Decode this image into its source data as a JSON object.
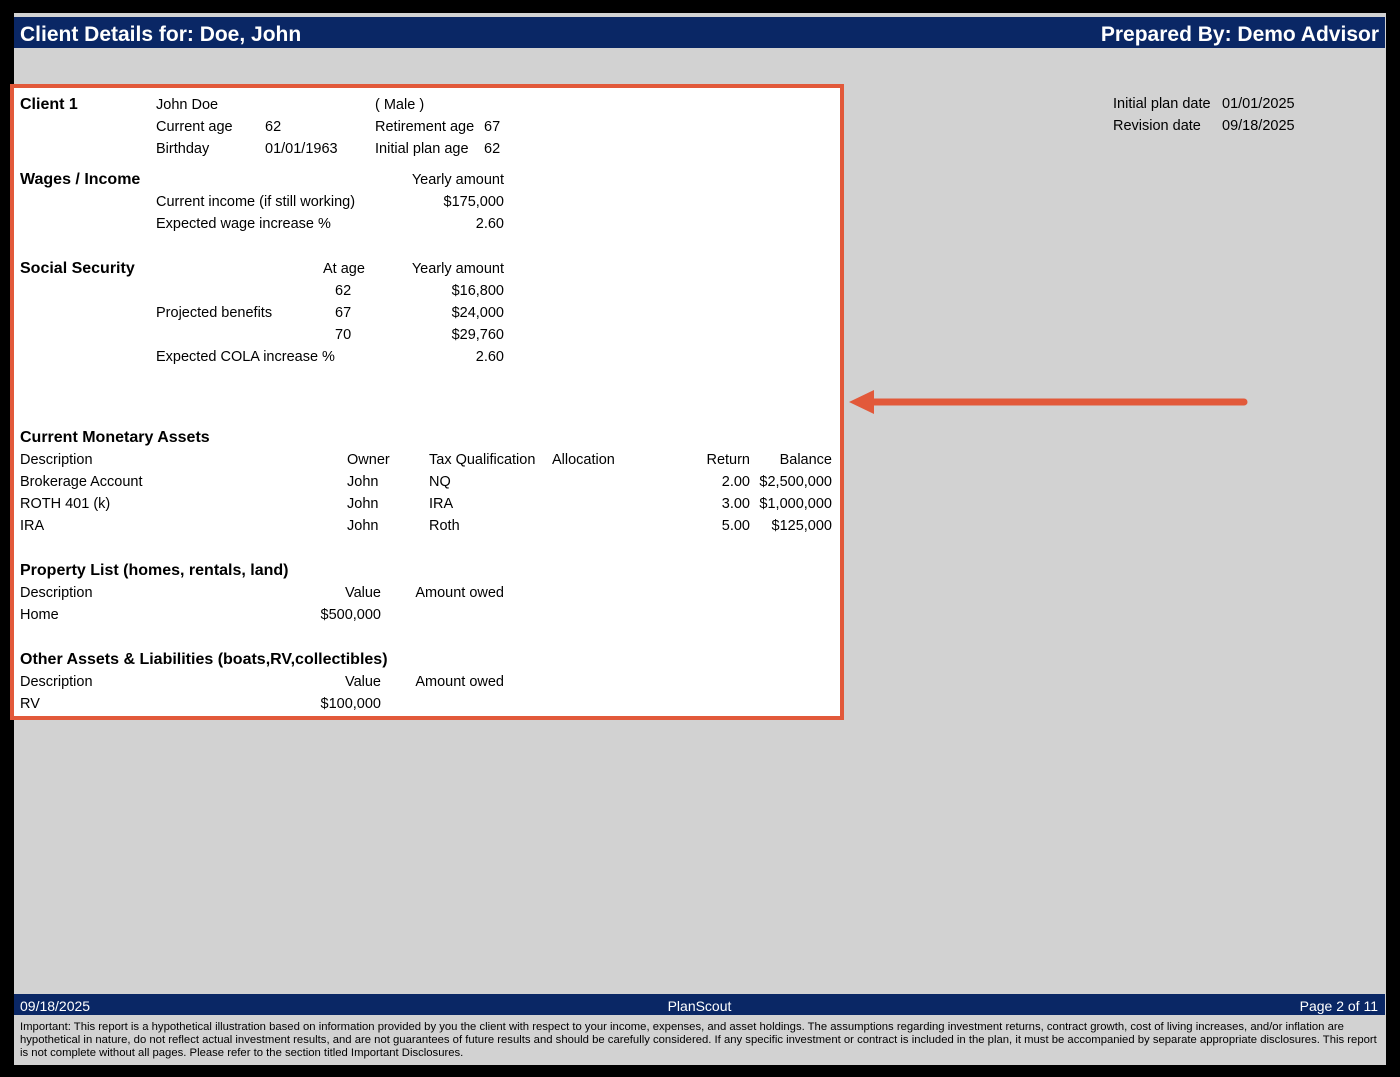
{
  "header": {
    "left": "Client Details for: Doe, John",
    "right": "Prepared By: Demo Advisor"
  },
  "dates": {
    "initial_label": "Initial plan date",
    "initial_value": "01/01/2025",
    "revision_label": "Revision date",
    "revision_value": "09/18/2025"
  },
  "client": {
    "heading": "Client 1",
    "name": "John Doe",
    "gender": "( Male )",
    "current_age_label": "Current age",
    "current_age": "62",
    "retirement_age_label": "Retirement age",
    "retirement_age": "67",
    "birthday_label": "Birthday",
    "birthday": "01/01/1963",
    "initial_plan_age_label": "Initial plan age",
    "initial_plan_age": "62"
  },
  "wages": {
    "heading": "Wages / Income",
    "col_yearly": "Yearly amount",
    "income_label": "Current income (if still working)",
    "income_value": "$175,000",
    "increase_label": "Expected wage increase %",
    "increase_value": "2.60"
  },
  "social_security": {
    "heading": "Social Security",
    "col_age": "At age",
    "col_yearly": "Yearly amount",
    "projected_label": "Projected benefits",
    "rows": [
      {
        "age": "62",
        "amount": "$16,800"
      },
      {
        "age": "67",
        "amount": "$24,000"
      },
      {
        "age": "70",
        "amount": "$29,760"
      }
    ],
    "cola_label": "Expected COLA increase %",
    "cola_value": "2.60"
  },
  "assets": {
    "heading": "Current Monetary Assets",
    "columns": {
      "description": "Description",
      "owner": "Owner",
      "tax": "Tax Qualification",
      "allocation": "Allocation",
      "return": "Return",
      "balance": "Balance"
    },
    "rows": [
      {
        "description": "Brokerage Account",
        "owner": "John",
        "tax": "NQ",
        "return": "2.00",
        "balance": "$2,500,000"
      },
      {
        "description": "ROTH 401 (k)",
        "owner": "John",
        "tax": "IRA",
        "return": "3.00",
        "balance": "$1,000,000"
      },
      {
        "description": "IRA",
        "owner": "John",
        "tax": "Roth",
        "return": "5.00",
        "balance": "$125,000"
      }
    ]
  },
  "property": {
    "heading": "Property List (homes, rentals, land)",
    "col_description": "Description",
    "col_value": "Value",
    "col_owed": "Amount owed",
    "rows": [
      {
        "description": "Home",
        "value": "$500,000"
      }
    ]
  },
  "other": {
    "heading": "Other Assets & Liabilities (boats,RV,collectibles)",
    "col_description": "Description",
    "col_value": "Value",
    "col_owed": "Amount owed",
    "rows": [
      {
        "description": "RV",
        "value": "$100,000"
      }
    ]
  },
  "footer": {
    "date": "09/18/2025",
    "brand": "PlanScout",
    "page": "Page 2 of 11",
    "disclaimer": "Important:  This report is a hypothetical illustration based on information provided by you the client with respect to your income, expenses, and asset holdings. The assumptions regarding investment returns, contract growth, cost of living increases, and/or inflation are hypothetical in nature, do not reflect actual investment results, and are not guarantees of future results and should be carefully considered. If any specific investment or contract is included in the plan, it must be accompanied by separate appropriate disclosures. This report is not complete without all pages. Please refer to the section titled Important Disclosures."
  },
  "colors": {
    "header_bg": "#0a2765",
    "highlight_border": "#e2593a",
    "page_bg": "#d2d2d2"
  }
}
